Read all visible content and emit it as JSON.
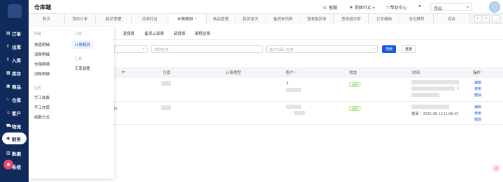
{
  "sidebar": {
    "items": [
      {
        "label": "订单",
        "icon": "list-icon",
        "icon_glyph": "▤",
        "active": false
      },
      {
        "label": "出库",
        "icon": "outbound-icon",
        "icon_glyph": "⇪",
        "active": false
      },
      {
        "label": "入库",
        "icon": "inbound-icon",
        "icon_glyph": "⇩",
        "active": false
      },
      {
        "label": "库存",
        "icon": "inventory-icon",
        "icon_glyph": "▦",
        "active": false
      },
      {
        "label": "商品",
        "icon": "goods-icon",
        "icon_glyph": "▣",
        "active": false
      },
      {
        "label": "仓库",
        "icon": "warehouse-icon",
        "icon_glyph": "⌂",
        "active": false
      },
      {
        "label": "客户",
        "icon": "customer-icon",
        "icon_glyph": "☺",
        "active": false
      },
      {
        "label": "物流",
        "icon": "truck-icon",
        "icon_glyph": "⛟",
        "active": false
      },
      {
        "label": "财务",
        "icon": "finance-icon",
        "icon_glyph": "◉",
        "active": true
      },
      {
        "label": "数据",
        "icon": "chart-icon",
        "icon_glyph": "▥",
        "active": false
      },
      {
        "label": "系统",
        "icon": "system-icon",
        "icon_glyph": "⚙",
        "active": false
      }
    ]
  },
  "header": {
    "title": "仓库端",
    "links": [
      {
        "label": "客服",
        "icon": "headset-icon",
        "glyph": "☏"
      },
      {
        "label": "简体中文",
        "icon": "language-icon",
        "glyph": "⚑"
      },
      {
        "label": "帮助中心",
        "icon": "help-icon",
        "glyph": "?"
      }
    ],
    "bell_glyph": "🔔",
    "warehouse_value": "仓山",
    "caret": "▾"
  },
  "tabs": {
    "items": [
      {
        "label": "首页",
        "active": false
      },
      {
        "label": "我的订单",
        "active": false
      },
      {
        "label": "拣货管理",
        "active": false
      },
      {
        "label": "拣单打包",
        "active": false
      },
      {
        "label": "计费规则",
        "active": true
      },
      {
        "label": "商品管理",
        "active": false
      },
      {
        "label": "拣货波次",
        "active": false
      },
      {
        "label": "备货单列表",
        "active": false
      },
      {
        "label": "签收集货单",
        "active": false
      },
      {
        "label": "签收退货单",
        "active": false
      },
      {
        "label": "打印模板",
        "active": false
      },
      {
        "label": "仓位推荐",
        "active": false
      },
      {
        "label": "库存",
        "active": false
      }
    ],
    "close_glyph": "×",
    "prev_glyph": "‹",
    "next_glyph": "›",
    "more_glyph": "⋯"
  },
  "subtabs": [
    "退货费",
    "备货上架费",
    "卸货费",
    "尾程运费"
  ],
  "filters": {
    "rule_name_placeholder": "规则名称",
    "customer_placeholder": "客户代码 / 名称",
    "search_label": "搜索",
    "reset_label": "重置"
  },
  "table": {
    "columns": [
      "仓库",
      "计费类型",
      "客户",
      "状态",
      "时间",
      "操作"
    ],
    "rows": [
      {
        "customer_count": "1",
        "status": "启用",
        "time_suffix": "1",
        "ops": [
          "编辑",
          "使用",
          "删除"
        ]
      },
      {
        "col1_suffix": "市",
        "status": "启用",
        "time": "更新：2025-06-13 11:56:42",
        "ops": [
          "编辑",
          "使用",
          "删除"
        ]
      }
    ]
  },
  "popup": {
    "group1": "明细",
    "group1_items": [
      "充值明细",
      "消费明细",
      "仓租明细",
      "对账明细"
    ],
    "group2": "应收",
    "group2_items": [
      "手工收费",
      "手工充值",
      "收款方式"
    ],
    "col2_group1": "计费",
    "col2_group1_items": [
      "计费规则"
    ],
    "col2_group2": "汇率",
    "col2_group2_items": [
      "汇率设置"
    ]
  },
  "colors": {
    "primary": "#1a56db",
    "sidebar": "#102a5c",
    "success": "#52c41a"
  }
}
